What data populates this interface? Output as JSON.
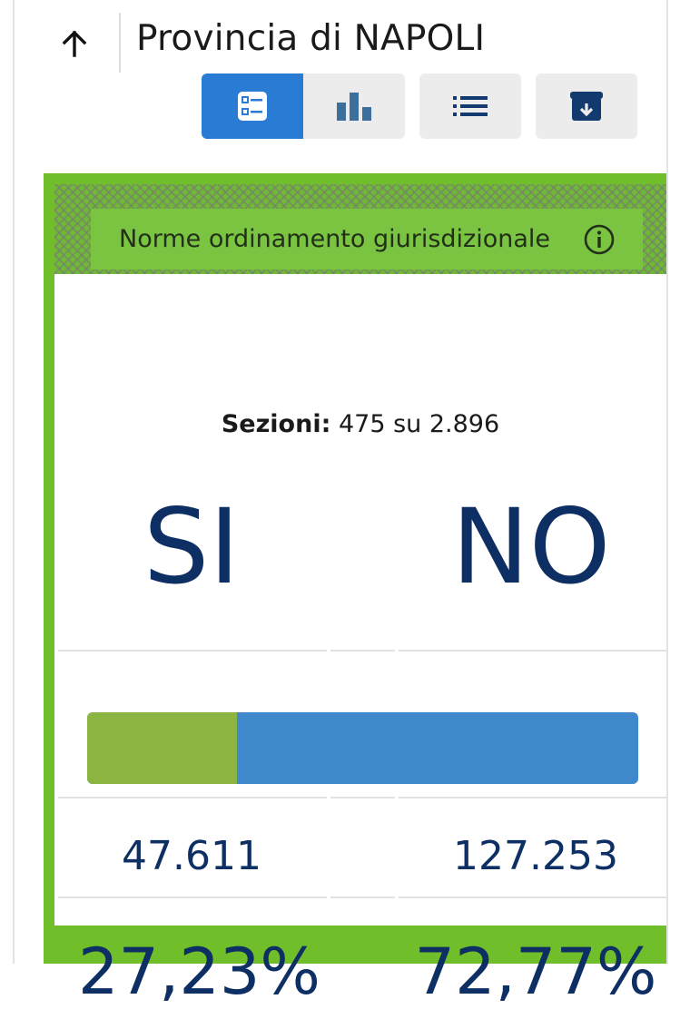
{
  "header": {
    "title": "Provincia di NAPOLI",
    "back_icon": "arrow-up-icon"
  },
  "toolbar": [
    {
      "icon": "summary-cards-icon",
      "active": true
    },
    {
      "icon": "bar-chart-icon",
      "active": false
    },
    {
      "icon": "list-icon",
      "active": false
    },
    {
      "icon": "archive-download-icon",
      "active": false
    }
  ],
  "card": {
    "topic": "Norme ordinamento giurisdizionale",
    "info_icon": "info-icon",
    "sezioni": {
      "label": "Sezioni:",
      "value": "475 su 2.896"
    },
    "options": {
      "si": {
        "label": "SI",
        "votes": "47.611",
        "percent": "27,23%",
        "share": 27.23,
        "color": "#8bb540"
      },
      "no": {
        "label": "NO",
        "votes": "127.253",
        "percent": "72,77%",
        "share": 72.77,
        "color": "#3f88cc"
      }
    }
  },
  "colors": {
    "accent": "#2a7bd3",
    "card_border": "#6fbe2a",
    "text_dark_blue": "#0d2f63"
  }
}
